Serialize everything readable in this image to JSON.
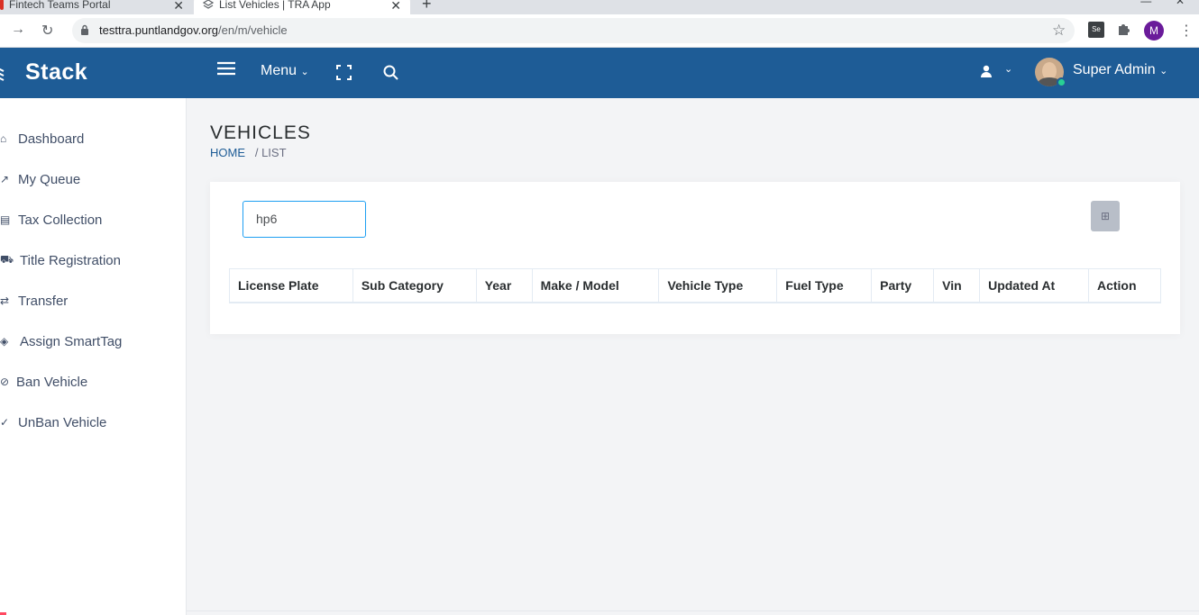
{
  "browser": {
    "tabs": [
      {
        "title": "Fintech Teams Portal"
      },
      {
        "title": "List Vehicles | TRA App"
      }
    ],
    "url_host": "testtra.puntlandgov.org",
    "url_path": "/en/m/vehicle",
    "profile_initial": "M"
  },
  "header": {
    "brand": "Stack",
    "menu_label": "Menu",
    "user_name": "Super Admin"
  },
  "sidebar": {
    "items": [
      {
        "label": "Dashboard",
        "icon": "home-icon"
      },
      {
        "label": "My Queue",
        "icon": "queue-icon"
      },
      {
        "label": "Tax Collection",
        "icon": "tax-icon"
      },
      {
        "label": "Title Registration",
        "icon": "car-icon"
      },
      {
        "label": "Transfer",
        "icon": "transfer-icon"
      },
      {
        "label": "Assign SmartTag",
        "icon": "tag-icon"
      },
      {
        "label": "Ban Vehicle",
        "icon": "ban-icon"
      },
      {
        "label": "UnBan Vehicle",
        "icon": "unban-icon"
      }
    ]
  },
  "page": {
    "title": "VEHICLES",
    "breadcrumb_home": "HOME",
    "breadcrumb_current": "/ LIST"
  },
  "search": {
    "value": "hp6"
  },
  "table": {
    "columns": [
      "License Plate",
      "Sub Category",
      "Year",
      "Make / Model",
      "Vehicle Type",
      "Fuel Type",
      "Party",
      "Vin",
      "Updated At",
      "Action"
    ]
  },
  "colors": {
    "header_bg": "#1e5c96",
    "accent": "#1e9ff2",
    "online": "#28d094"
  }
}
